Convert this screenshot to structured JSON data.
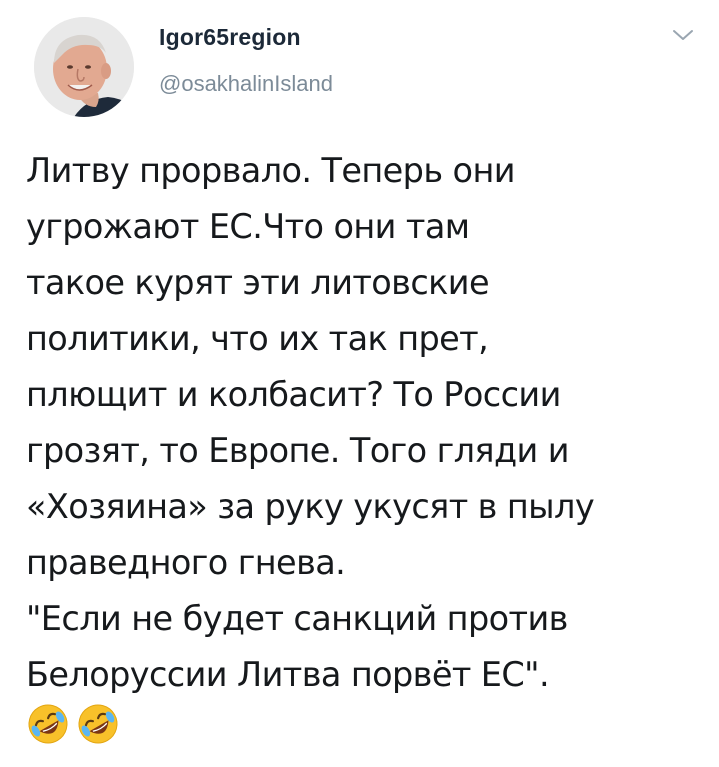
{
  "author": {
    "display_name": "Igor65region",
    "handle": "@osakhalinIsland",
    "avatar_icon": "user-avatar-photo"
  },
  "menu": {
    "icon": "chevron-down-icon"
  },
  "tweet": {
    "lines": [
      "Литву прорвало. Теперь они",
      "угрожают ЕС.Что они там",
      "такое курят эти литовские",
      "политики, что их так прет,",
      "плющит и колбасит? То России",
      "грозят, то Европе. Того гляди и",
      "«Хозяина» за руку укусят в пылу",
      "праведного гнева.",
      "\"Если не будет санкций против",
      "Белоруссии Литва порвёт ЕС\"."
    ],
    "emojis": [
      "rolling-on-floor-laughing-emoji",
      "rolling-on-floor-laughing-emoji"
    ]
  },
  "colors": {
    "text": "#16191c",
    "name": "#1c2938",
    "handle": "#7c8b98",
    "background": "#ffffff"
  }
}
